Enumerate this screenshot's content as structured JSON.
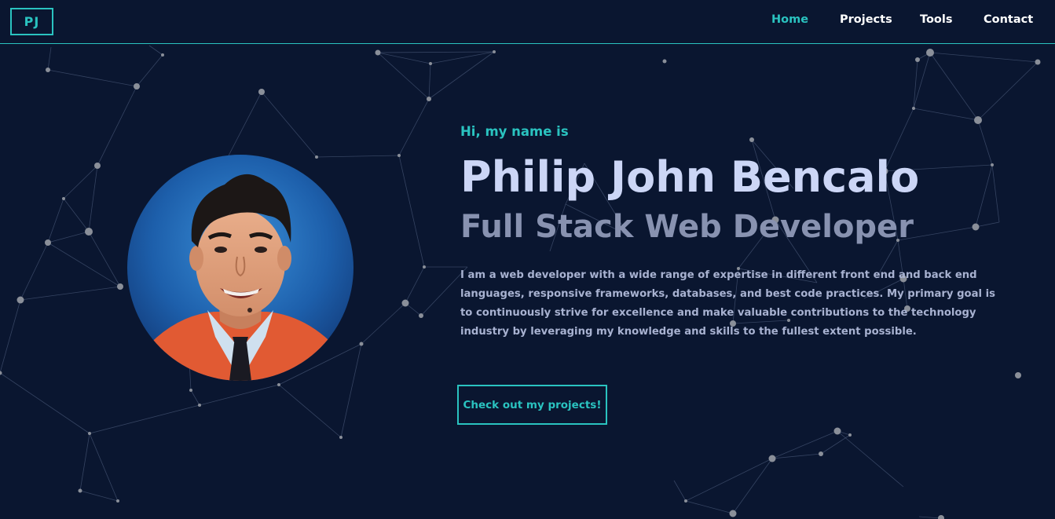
{
  "nav": {
    "logo": "PJ",
    "links": [
      {
        "label": "Home",
        "active": true
      },
      {
        "label": "Projects",
        "active": false
      },
      {
        "label": "Tools",
        "active": false
      },
      {
        "label": "Contact",
        "active": false
      }
    ]
  },
  "hero": {
    "greeting": "Hi, my name is",
    "name": "Philip John Bencalo",
    "role": "Full Stack Web Developer",
    "bio": "I am a web developer with a wide range of expertise in different front end and back end languages, responsive frameworks, databases, and best code practices. My primary goal is to continuously strive for excellence and make valuable contributions to the technology industry by leveraging my knowledge and skills to the fullest extent possible.",
    "cta_label": "Check out my projects!"
  },
  "colors": {
    "background": "#0a1630",
    "accent": "#2ac3c0",
    "heading": "#ccd6f6",
    "subheading": "#8892b0",
    "body_text": "#a8b2d1"
  },
  "icons": {
    "background": "particle-network-icon",
    "photo": "profile-photo"
  }
}
